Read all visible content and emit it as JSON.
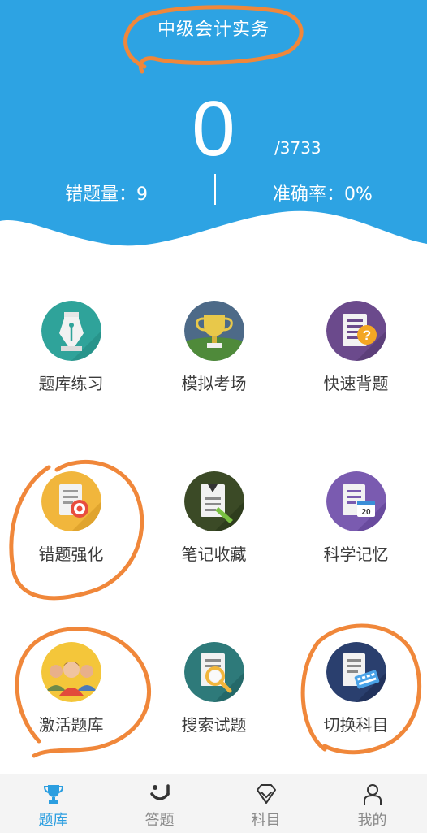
{
  "header": {
    "title": "中级会计实务",
    "score": "0",
    "total": "/3733",
    "wrong_count": "错题量：9",
    "accuracy": "准确率：0%",
    "bg_color": "#2da3e3"
  },
  "menu": {
    "items": [
      {
        "label": "题库练习",
        "icon": "pen-nib-icon"
      },
      {
        "label": "模拟考场",
        "icon": "trophy-icon"
      },
      {
        "label": "快速背题",
        "icon": "question-document-icon"
      },
      {
        "label": "错题强化",
        "icon": "target-document-icon"
      },
      {
        "label": "笔记收藏",
        "icon": "pencil-document-icon"
      },
      {
        "label": "科学记忆",
        "icon": "calendar-document-icon"
      },
      {
        "label": "激活题库",
        "icon": "people-icon"
      },
      {
        "label": "搜索试题",
        "icon": "magnifier-document-icon"
      },
      {
        "label": "切换科目",
        "icon": "keyboard-document-icon"
      }
    ]
  },
  "tabbar": {
    "tabs": [
      {
        "label": "题库",
        "icon": "trophy-icon",
        "active": true
      },
      {
        "label": "答题",
        "icon": "answer-icon",
        "active": false
      },
      {
        "label": "科目",
        "icon": "diamond-icon",
        "active": false
      },
      {
        "label": "我的",
        "icon": "person-icon",
        "active": false
      }
    ],
    "active_color": "#2b9ee0",
    "inactive_color": "#8a8a8a"
  },
  "annotation_color": "#f0873a"
}
